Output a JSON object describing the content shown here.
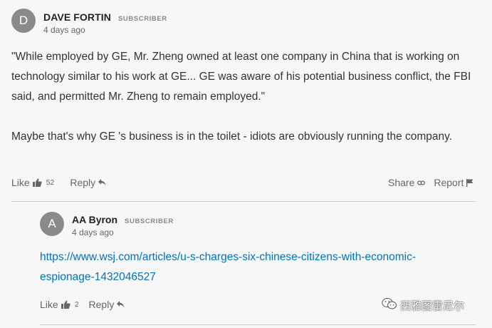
{
  "comment": {
    "avatar_initial": "D",
    "author": "DAVE FORTIN",
    "badge": "SUBSCRIBER",
    "timestamp": "4 days ago",
    "body_line_1": "\"While employed by GE, Mr. Zheng owned at least one company in China that is working on",
    "body_line_2": "technology similar to his work at GE...  GE was aware of his potential business conflict, the FBI",
    "body_line_3": "said, and permitted Mr. Zheng to remain employed.\"",
    "body_paragraph_2": "Maybe that's why GE 's business is in the toilet - idiots are obviously running the company.",
    "actions": {
      "like_label": "Like",
      "like_count": "52",
      "reply_label": "Reply",
      "share_label": "Share",
      "report_label": "Report"
    }
  },
  "reply": {
    "avatar_initial": "A",
    "author": "AA Byron",
    "badge": "SUBSCRIBER",
    "timestamp": "4 days ago",
    "link_line_1": "https://www.wsj.com/articles/u-s-charges-six-chinese-citizens-with-economic-",
    "link_line_2": "espionage-1432046527",
    "actions": {
      "like_label": "Like",
      "like_count": "2",
      "reply_label": "Reply"
    }
  },
  "watermark": {
    "text": "西雅图雷尼尔"
  },
  "colors": {
    "background": "#f7f7f7",
    "avatar": "#8a8a8a",
    "link": "#0274b6",
    "divider": "#cfcfcf"
  },
  "icons": [
    "thumbs-up-icon",
    "reply-arrow-icon",
    "share-icon",
    "flag-icon",
    "wechat-icon"
  ]
}
